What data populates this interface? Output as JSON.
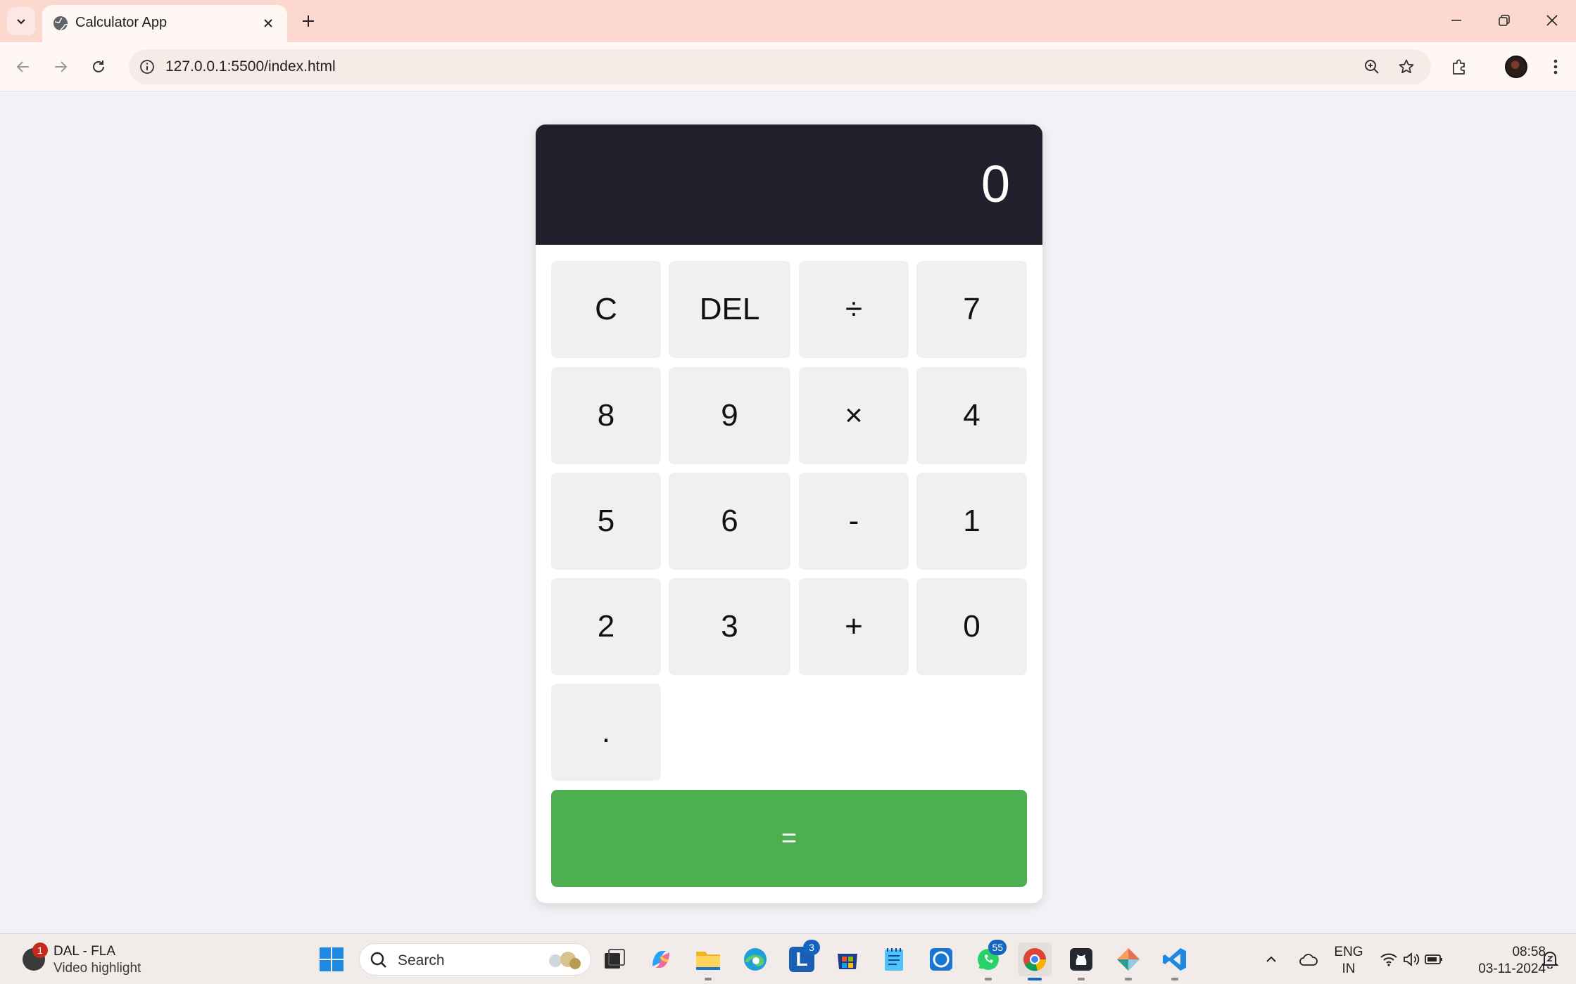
{
  "browser": {
    "tab_title": "Calculator App",
    "url": "127.0.0.1:5500/index.html"
  },
  "calculator": {
    "display_value": "0",
    "keys": [
      "C",
      "DEL",
      "÷",
      "7",
      "8",
      "9",
      "×",
      "4",
      "5",
      "6",
      "-",
      "1",
      "2",
      "3",
      "+",
      "0",
      "."
    ],
    "equals_label": "=",
    "colors": {
      "display_bg": "#1f202c",
      "key_bg": "#f0f0f0",
      "equals_bg": "#4caf50"
    }
  },
  "taskbar": {
    "widget_title": "DAL - FLA",
    "widget_subtitle": "Video highlight",
    "widget_badge": "1",
    "search_label": "Search",
    "letterbox_badge": "3",
    "whatsapp_badge": "55",
    "language_line1": "ENG",
    "language_line2": "IN",
    "time": "08:58",
    "date": "03-11-2024"
  }
}
